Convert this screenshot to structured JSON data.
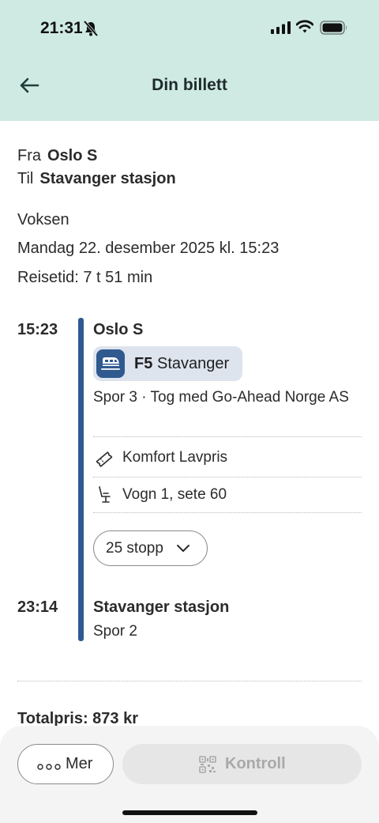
{
  "status_bar": {
    "time": "21:31"
  },
  "header": {
    "title": "Din billett"
  },
  "trip": {
    "from_label": "Fra",
    "from": "Oslo S",
    "to_label": "Til",
    "to": "Stavanger stasjon",
    "passenger": "Voksen",
    "date": "Mandag 22. desember 2025 kl. 15:23",
    "duration": "Reisetid: 7 t 51 min"
  },
  "leg": {
    "departure_time": "15:23",
    "departure_station": "Oslo S",
    "line": "F5",
    "line_destination": "Stavanger",
    "platform_operator": "Spor 3 · Tog med Go-Ahead Norge AS",
    "fare_product": "Komfort Lavpris",
    "seat": "Vogn 1, sete 60",
    "stops_label": "25 stopp",
    "arrival_time": "23:14",
    "arrival_station": "Stavanger stasjon",
    "arrival_platform": "Spor 2",
    "line_color": "#30598f"
  },
  "summary": {
    "total": "Totalpris: 873 kr"
  },
  "actions": {
    "more_label": "Mer",
    "control_label": "Kontroll"
  },
  "colors": {
    "header_bg": "#cfeae3",
    "accent": "#30598f"
  }
}
